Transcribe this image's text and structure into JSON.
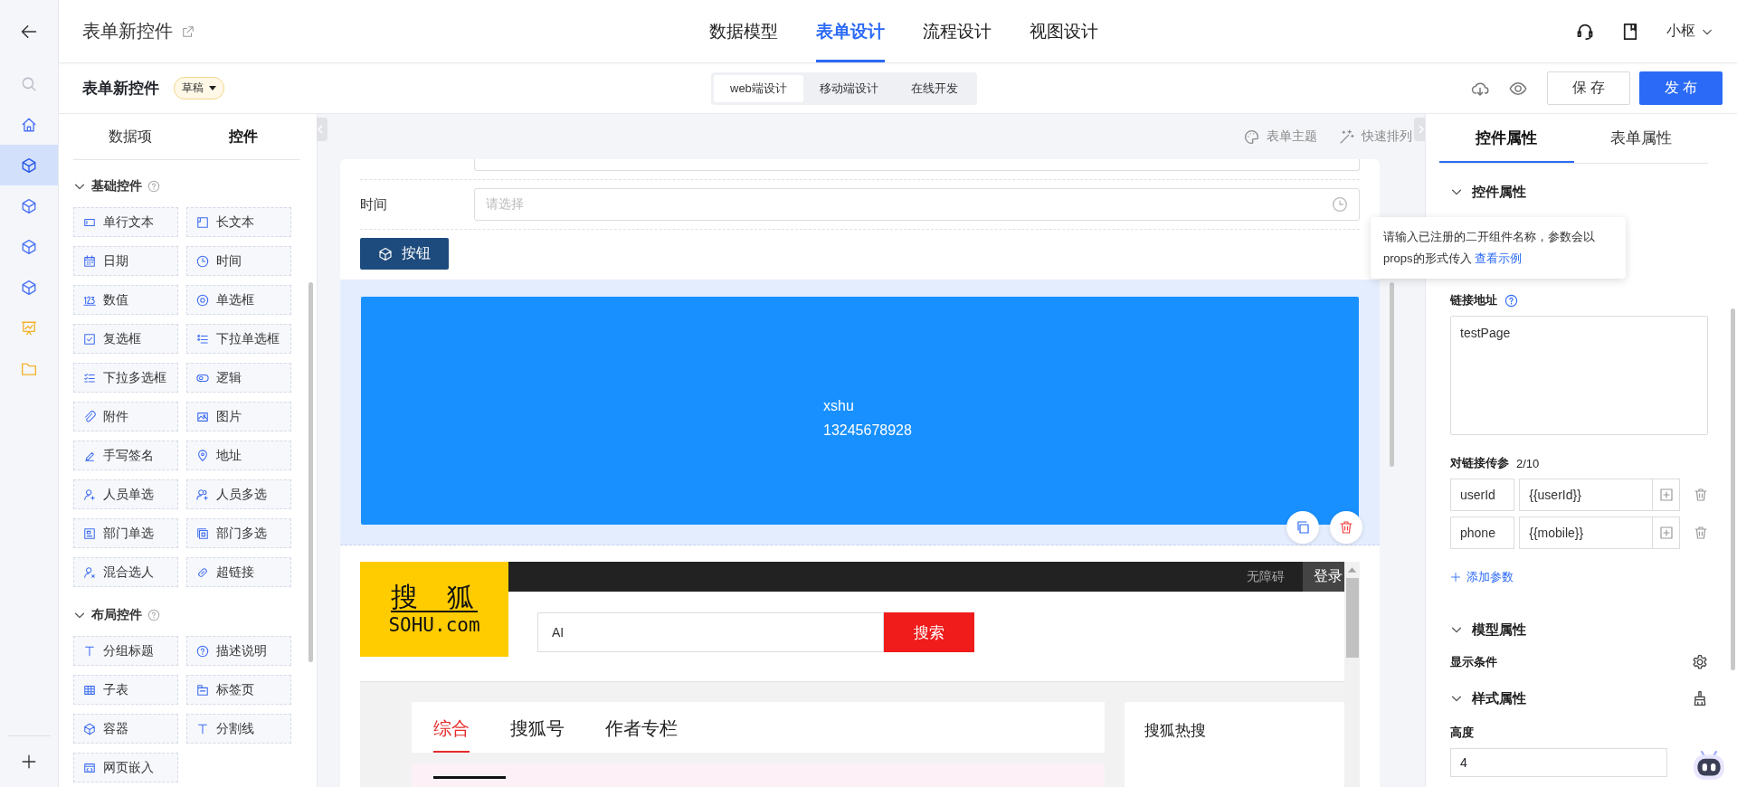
{
  "rail": {
    "items": [
      {
        "kind": "search",
        "selected": false
      },
      {
        "kind": "home",
        "selected": false
      },
      {
        "kind": "cube",
        "selected": true
      },
      {
        "kind": "cube",
        "selected": false
      },
      {
        "kind": "cube",
        "selected": false
      },
      {
        "kind": "cube",
        "selected": false
      },
      {
        "kind": "chart",
        "selected": false
      },
      {
        "kind": "folder",
        "selected": false
      }
    ]
  },
  "header": {
    "title": "表单新控件",
    "nav": [
      {
        "label": "数据模型",
        "selected": false
      },
      {
        "label": "表单设计",
        "selected": true
      },
      {
        "label": "流程设计",
        "selected": false
      },
      {
        "label": "视图设计",
        "selected": false
      }
    ],
    "user": "小枢"
  },
  "toolbar": {
    "title": "表单新控件",
    "status": "草稿",
    "modes": [
      {
        "label": "web端设计",
        "selected": true
      },
      {
        "label": "移动端设计",
        "selected": false
      },
      {
        "label": "在线开发",
        "selected": false
      }
    ],
    "buttons": [
      {
        "label": "保 存",
        "kind": "default"
      },
      {
        "label": "发 布",
        "kind": "primary"
      }
    ]
  },
  "palette": {
    "tabs": [
      {
        "label": "数据项",
        "selected": false
      },
      {
        "label": "控件",
        "selected": true
      }
    ],
    "groups": [
      {
        "title": "基础控件",
        "expanded": true,
        "items": [
          {
            "label": "单行文本",
            "kind": "input"
          },
          {
            "label": "长文本",
            "kind": "textarea"
          },
          {
            "label": "日期",
            "kind": "date"
          },
          {
            "label": "时间",
            "kind": "time"
          },
          {
            "label": "数值",
            "kind": "number"
          },
          {
            "label": "单选框",
            "kind": "radio"
          },
          {
            "label": "复选框",
            "kind": "checkbox"
          },
          {
            "label": "下拉单选框",
            "kind": "select"
          },
          {
            "label": "下拉多选框",
            "kind": "multiselect"
          },
          {
            "label": "逻辑",
            "kind": "switch"
          },
          {
            "label": "附件",
            "kind": "attachment"
          },
          {
            "label": "图片",
            "kind": "image"
          },
          {
            "label": "手写签名",
            "kind": "signature"
          },
          {
            "label": "地址",
            "kind": "location"
          },
          {
            "label": "人员单选",
            "kind": "user"
          },
          {
            "label": "人员多选",
            "kind": "users"
          },
          {
            "label": "部门单选",
            "kind": "dept"
          },
          {
            "label": "部门多选",
            "kind": "depts"
          },
          {
            "label": "混合选人",
            "kind": "mixed"
          },
          {
            "label": "超链接",
            "kind": "link"
          }
        ]
      },
      {
        "title": "布局控件",
        "expanded": true,
        "items": [
          {
            "label": "分组标题",
            "kind": "heading"
          },
          {
            "label": "描述说明",
            "kind": "help"
          },
          {
            "label": "子表",
            "kind": "table"
          },
          {
            "label": "标签页",
            "kind": "tabs"
          },
          {
            "label": "容器",
            "kind": "cube"
          },
          {
            "label": "分割线",
            "kind": "heading"
          },
          {
            "label": "网页嵌入",
            "kind": "web"
          }
        ]
      }
    ]
  },
  "canvas": {
    "tools": [
      {
        "kind": "palette",
        "label": "表单主题"
      },
      {
        "kind": "wand",
        "label": "快速排列"
      }
    ],
    "field": {
      "label": "时间",
      "placeholder": "请选择"
    },
    "button": "按钮",
    "block": {
      "selected": true,
      "lines": [
        "xshu",
        "13245678928"
      ]
    },
    "embed": {
      "logo_top": "搜  狐",
      "logo_bottom": "SOHU.com",
      "links": [
        "无障碍",
        "登录"
      ],
      "search_value": "AI",
      "search_button": "搜索",
      "tabs": [
        {
          "label": "综合",
          "selected": true
        },
        {
          "label": "搜狐号",
          "selected": false
        },
        {
          "label": "作者专栏",
          "selected": false
        }
      ],
      "side_title": "搜狐热搜"
    }
  },
  "tooltip": {
    "text": "请输入已注册的二开组件名称，参数会以props的形式传入",
    "link": "查看示例"
  },
  "properties": {
    "tabs": [
      {
        "label": "控件属性",
        "selected": true
      },
      {
        "label": "表单属性",
        "selected": false
      }
    ],
    "control_section": {
      "title": "控件属性",
      "expanded": true
    },
    "link": {
      "label": "链接地址",
      "value": "testPage"
    },
    "params": {
      "label": "对链接传参",
      "count": "2/10",
      "rows": [
        {
          "key": "userId",
          "value": "{{userId}}"
        },
        {
          "key": "phone",
          "value": "{{mobile}}"
        }
      ],
      "add": "添加参数"
    },
    "model_section": {
      "title": "模型属性",
      "expanded": true,
      "condition": "显示条件"
    },
    "style_section": {
      "title": "样式属性",
      "expanded": true,
      "height_label": "高度",
      "height_value": "4"
    }
  }
}
